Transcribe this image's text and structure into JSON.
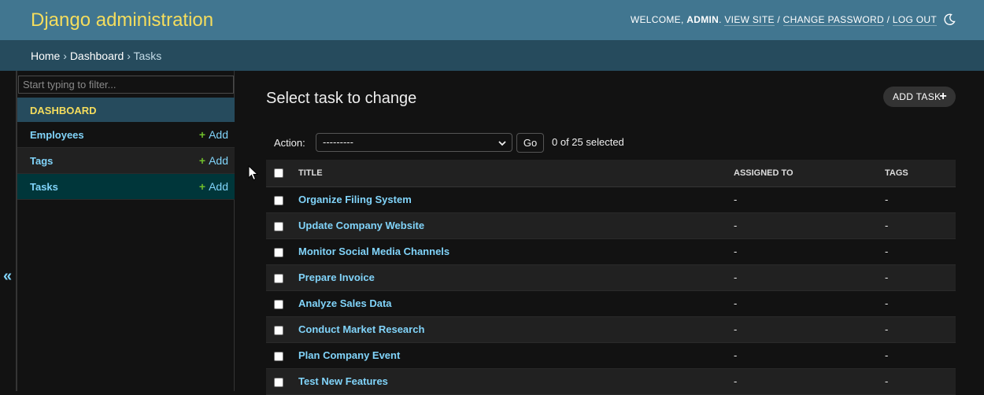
{
  "header": {
    "brand": "Django administration",
    "welcome": "WELCOME,",
    "username": "ADMIN",
    "view_site": "VIEW SITE",
    "change_password": "CHANGE PASSWORD",
    "log_out": "LOG OUT",
    "separator": "/"
  },
  "breadcrumbs": {
    "home": "Home",
    "dashboard": "Dashboard",
    "current": "Tasks",
    "separator": "›"
  },
  "sidebar": {
    "filter_placeholder": "Start typing to filter...",
    "collapse_glyph": "«",
    "module_caption": "Dashboard",
    "items": [
      {
        "label": "Employees",
        "add": "Add"
      },
      {
        "label": "Tags",
        "add": "Add"
      },
      {
        "label": "Tasks",
        "add": "Add"
      }
    ]
  },
  "content": {
    "title": "Select task to change",
    "add_button": "ADD TASK",
    "actions": {
      "label": "Action:",
      "selected_option": "---------",
      "go": "Go",
      "counter": "0 of 25 selected"
    },
    "table": {
      "columns": [
        "Title",
        "Assigned to",
        "Tags"
      ],
      "rows": [
        {
          "title": "Organize Filing System",
          "assigned": "-",
          "tags": "-"
        },
        {
          "title": "Update Company Website",
          "assigned": "-",
          "tags": "-"
        },
        {
          "title": "Monitor Social Media Channels",
          "assigned": "-",
          "tags": "-"
        },
        {
          "title": "Prepare Invoice",
          "assigned": "-",
          "tags": "-"
        },
        {
          "title": "Analyze Sales Data",
          "assigned": "-",
          "tags": "-"
        },
        {
          "title": "Conduct Market Research",
          "assigned": "-",
          "tags": "-"
        },
        {
          "title": "Plan Company Event",
          "assigned": "-",
          "tags": "-"
        },
        {
          "title": "Test New Features",
          "assigned": "-",
          "tags": "-"
        }
      ]
    }
  },
  "colors": {
    "header_bg": "#417690",
    "brand": "#f5dd5d",
    "breadcrumbs_bg": "#264b5d",
    "link": "#81d4fa",
    "add_plus": "#70bf2b",
    "current_model_bg": "#00363a"
  }
}
